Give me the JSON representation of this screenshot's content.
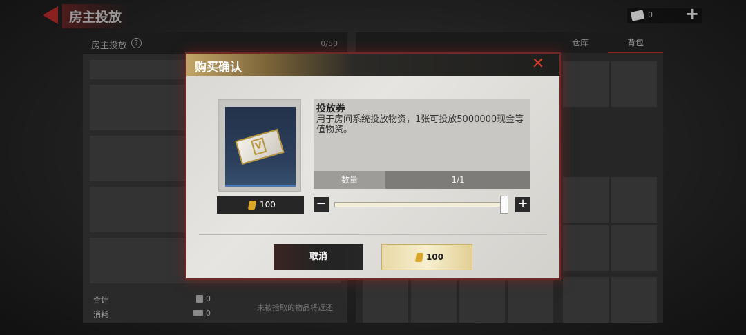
{
  "topbar": {
    "title": "房主投放",
    "currency_value": "0",
    "add_symbol": "+"
  },
  "left_panel": {
    "title": "房主投放",
    "help_symbol": "?",
    "capacity": "0/50",
    "total_label": "合计",
    "total_value": "0",
    "consume_label": "消耗",
    "consume_value": "0",
    "note": "未被拾取的物品将返还"
  },
  "right_panel": {
    "tabs": [
      {
        "label": "仓库",
        "active": false
      },
      {
        "label": "背包",
        "active": true
      }
    ]
  },
  "modal": {
    "title": "购买确认",
    "close_symbol": "✕",
    "item": {
      "name": "投放券",
      "description": "用于房间系统投放物资，1张可投放5000000现金等值物资。",
      "price": "100",
      "image_mark": "V"
    },
    "quantity": {
      "label": "数量",
      "value": "1/1",
      "minus_symbol": "−",
      "plus_symbol": "+",
      "slider_fraction": 1.0
    },
    "buttons": {
      "cancel_label": "取消",
      "confirm_price": "100"
    }
  },
  "colors": {
    "accent_red": "#8a2020",
    "gold": "#d9a627",
    "close_red": "#d83a2a"
  },
  "icons": [
    "back-arrow-icon",
    "help-icon",
    "coupon-icon",
    "close-icon",
    "minus-icon",
    "plus-icon"
  ]
}
